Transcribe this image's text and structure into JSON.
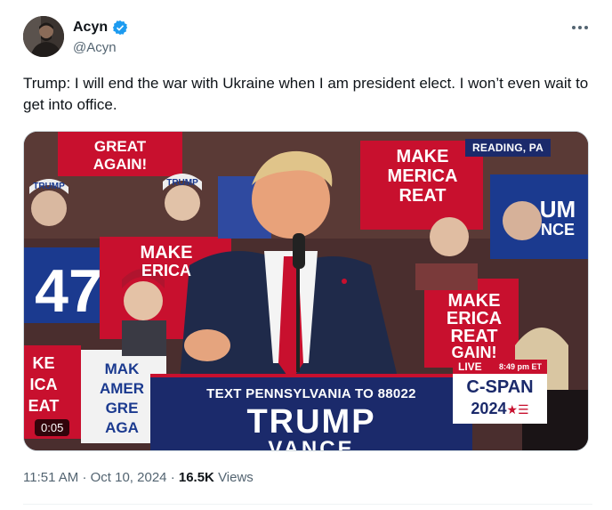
{
  "author": {
    "name": "Acyn",
    "handle": "@Acyn",
    "verified": true
  },
  "more_icon": "more-horizontal-icon",
  "text": "Trump: I will end the war with Ukraine when I am president elect. I won’t even wait to get into office.",
  "media": {
    "location": "READING, PA",
    "live_label": "LIVE",
    "live_time": "8:49 pm ET",
    "network_line1": "C-SPAN",
    "network_line2": "2024",
    "podium_sms_prefix": "TEXT PENNSYLVANIA TO",
    "podium_sms_number": "88022",
    "podium_name1": "TRUMP",
    "podium_name2": "VANCE",
    "duration": "0:05",
    "signs": {
      "great_again": "GREAT AGAIN!",
      "make_america_great": "MAKE AMERICA GREAT AGAIN!",
      "make_america": "MAKE AMERICA",
      "number_47": "47",
      "trump_hat": "TRUMP"
    }
  },
  "meta": {
    "time": "11:51 AM",
    "date": "Oct 10, 2024",
    "views_count": "16.5K",
    "views_label": "Views"
  },
  "colors": {
    "verified_blue": "#1d9bf0",
    "sign_red": "#c8102e",
    "sign_blue": "#1b3a8f",
    "cspan_navy": "#1b2a6b"
  }
}
